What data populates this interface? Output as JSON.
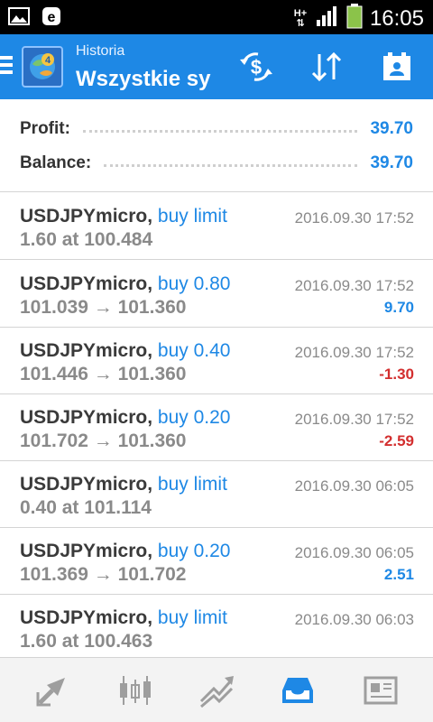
{
  "status_bar": {
    "net_top": "H+",
    "net_bottom": "⇅",
    "time": "16:05"
  },
  "header": {
    "subtitle": "Historia",
    "title": "Wszystkie sy…"
  },
  "summary": {
    "profit_label": "Profit:",
    "profit_value": "39.70",
    "balance_label": "Balance:",
    "balance_value": "39.70"
  },
  "deals": [
    {
      "symbol": "USDJPYmicro,",
      "type": "buy limit",
      "time": "2016.09.30 17:52",
      "prices": "1.60 at 100.484",
      "profit": "",
      "profit_sign": "none"
    },
    {
      "symbol": "USDJPYmicro,",
      "type": "buy 0.80",
      "time": "2016.09.30 17:52",
      "prices": "101.039 → 101.360",
      "profit": "9.70",
      "profit_sign": "positive"
    },
    {
      "symbol": "USDJPYmicro,",
      "type": "buy 0.40",
      "time": "2016.09.30 17:52",
      "prices": "101.446 → 101.360",
      "profit": "-1.30",
      "profit_sign": "negative"
    },
    {
      "symbol": "USDJPYmicro,",
      "type": "buy 0.20",
      "time": "2016.09.30 17:52",
      "prices": "101.702 → 101.360",
      "profit": "-2.59",
      "profit_sign": "negative"
    },
    {
      "symbol": "USDJPYmicro,",
      "type": "buy limit",
      "time": "2016.09.30 06:05",
      "prices": "0.40 at 101.114",
      "profit": "",
      "profit_sign": "none"
    },
    {
      "symbol": "USDJPYmicro,",
      "type": "buy 0.20",
      "time": "2016.09.30 06:05",
      "prices": "101.369 → 101.702",
      "profit": "2.51",
      "profit_sign": "positive"
    },
    {
      "symbol": "USDJPYmicro,",
      "type": "buy limit",
      "time": "2016.09.30 06:03",
      "prices": "1.60 at 100.463",
      "profit": "",
      "profit_sign": "none"
    }
  ],
  "icons": {
    "header": [
      "currency-exchange-icon",
      "sort-icon",
      "calendar-icon"
    ],
    "bottom_nav": [
      "quotes-icon",
      "chart-icon",
      "trade-icon",
      "history-icon",
      "news-icon"
    ],
    "active_nav": "history-icon"
  },
  "colors": {
    "accent": "#1e88e5",
    "negative": "#d32f2f",
    "header_bg": "#1e88e5",
    "nav_inactive": "#9e9e9e"
  }
}
